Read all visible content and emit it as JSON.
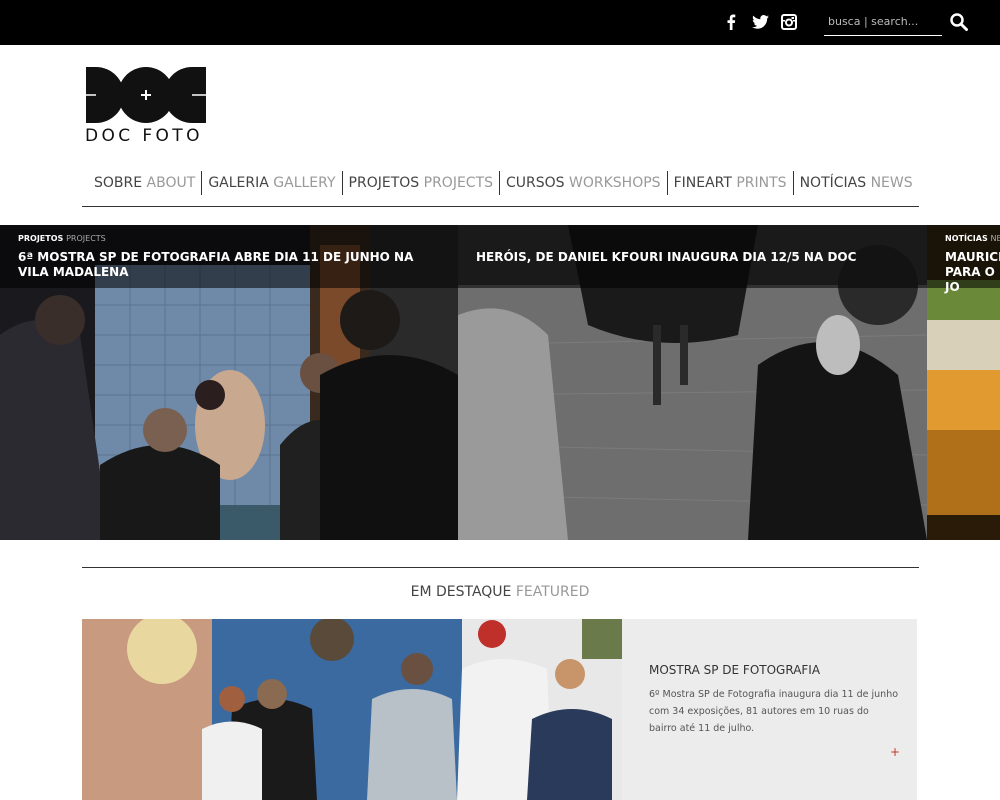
{
  "social": {
    "facebook": "facebook-icon",
    "twitter": "twitter-icon",
    "instagram": "instagram-icon"
  },
  "search": {
    "placeholder": "busca | search..."
  },
  "logo": {
    "text": "DOC FOTO"
  },
  "nav": [
    {
      "pt": "SOBRE",
      "en": "ABOUT"
    },
    {
      "pt": "GALERIA",
      "en": "GALLERY"
    },
    {
      "pt": "PROJETOS",
      "en": "PROJECTS"
    },
    {
      "pt": "CURSOS",
      "en": "WORKSHOPS"
    },
    {
      "pt": "FINEART",
      "en": "PRINTS"
    },
    {
      "pt": "NOTÍCIAS",
      "en": "NEWS"
    }
  ],
  "slides": [
    {
      "cat_pt": "PROJETOS",
      "cat_en": "PROJECTS",
      "title": "6ª MOSTRA SP DE FOTOGRAFIA ABRE DIA 11 DE JUNHO NA VILA MADALENA"
    },
    {
      "cat_pt": "",
      "cat_en": "",
      "title": "HERÓIS, DE DANIEL KFOURI INAUGURA DIA 12/5 NA DOC"
    },
    {
      "cat_pt": "NOTÍCIAS",
      "cat_en": "NEWS",
      "title": "MAURICIO PARA O JO"
    }
  ],
  "featured": {
    "heading_pt": "EM DESTAQUE",
    "heading_en": "FEATURED",
    "title": "MOSTRA SP DE FOTOGRAFIA",
    "description": "6º Mostra SP de Fotografia inaugura dia 11 de junho com 34 exposições, 81 autores em 10 ruas do bairro até 11 de julho.",
    "more": "+"
  },
  "colors": {
    "topbar": "#000000",
    "accent_plus": "#c0392b",
    "featured_bg": "#ececec"
  }
}
